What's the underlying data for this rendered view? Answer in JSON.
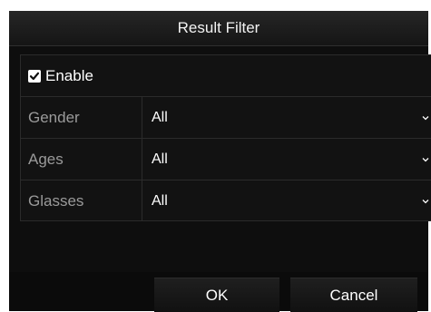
{
  "dialog": {
    "title": "Result Filter"
  },
  "enable": {
    "label": "Enable",
    "checked": true
  },
  "filters": [
    {
      "label": "Gender",
      "value": "All"
    },
    {
      "label": "Ages",
      "value": "All"
    },
    {
      "label": "Glasses",
      "value": "All"
    }
  ],
  "buttons": {
    "ok_label": "OK",
    "cancel_label": "Cancel"
  },
  "colors": {
    "background": "#0e0e0e",
    "text": "#ffffff",
    "label_text": "#9a9a9a",
    "border": "#2b2b2b"
  },
  "icons": {
    "checkbox": "checkmark-icon",
    "dropdown": "chevron-down-icon"
  }
}
